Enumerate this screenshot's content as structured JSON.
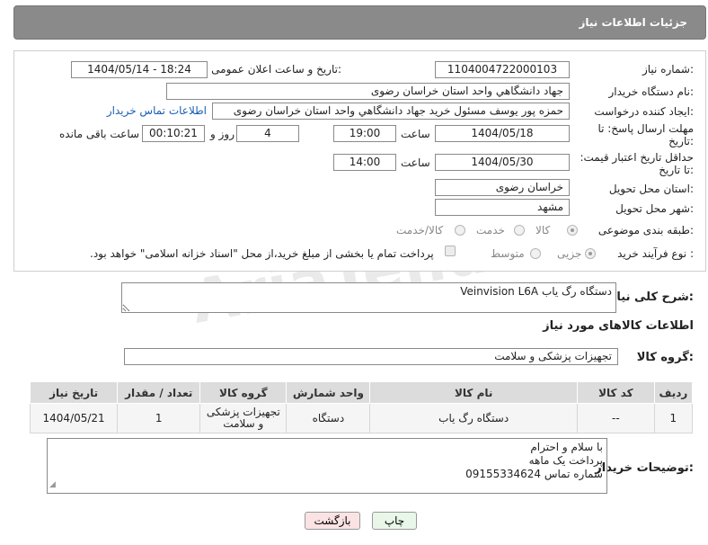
{
  "header": {
    "title": "جزئیات اطلاعات نیاز"
  },
  "form": {
    "need_number": {
      "label": "شماره نیاز:",
      "value": "1104004722000103"
    },
    "announce_datetime": {
      "label": "تاریخ و ساعت اعلان عمومی:",
      "value": "1404/05/14 - 18:24"
    },
    "buyer_org": {
      "label": "نام دستگاه خریدار:",
      "value": "جهاد دانشگاهي واحد استان خراسان رضوی"
    },
    "requester": {
      "label": "ایجاد کننده درخواست:",
      "value": "حمزه  پور یوسف مسئول خرید جهاد دانشگاهي واحد استان خراسان رضوی",
      "contact_link": "اطلاعات تماس خریدار"
    },
    "reply_deadline": {
      "label": "مهلت ارسال پاسخ: تا تاریخ:",
      "date": "1404/05/18",
      "time_label": "ساعت",
      "time": "19:00",
      "days": "4",
      "days_label": "روز و",
      "remaining": "00:10:21",
      "remaining_label": "ساعت باقی مانده"
    },
    "price_validity": {
      "label": "حداقل تاریخ اعتبار قیمت: تا تاریخ:",
      "date": "1404/05/30",
      "time_label": "ساعت",
      "time": "14:00"
    },
    "delivery_province": {
      "label": "استان محل تحویل:",
      "value": "خراسان رضوی"
    },
    "delivery_city": {
      "label": "شهر محل تحویل:",
      "value": "مشهد"
    },
    "category": {
      "label": "طبقه بندی موضوعی:",
      "options": [
        "کالا",
        "خدمت",
        "کالا/خدمت"
      ],
      "selected": "کالا"
    },
    "purchase_type": {
      "label": "نوع فرآیند خرید :",
      "options": [
        "جزیی",
        "متوسط"
      ],
      "selected": "جزیی",
      "note": "پرداخت تمام یا بخشی از مبلغ خرید،از محل \"اسناد خزانه اسلامی\" خواهد بود."
    }
  },
  "description": {
    "label": "شرح کلی نیاز:",
    "value": "دستگاه رگ یاب Veinvision L6A"
  },
  "goods_section": {
    "title": "اطلاعات کالاهای مورد نیاز",
    "group_label": "گروه کالا:",
    "group_value": "تجهیزات پزشکی و سلامت"
  },
  "table": {
    "headers": [
      "ردیف",
      "کد کالا",
      "نام کالا",
      "واحد شمارش",
      "گروه کالا",
      "تعداد / مقدار",
      "تاریخ نیاز"
    ],
    "rows": [
      [
        "1",
        "--",
        "دستگاه رگ یاب",
        "دستگاه",
        "تجهیزات پزشکی و سلامت",
        "1",
        "1404/05/21"
      ]
    ]
  },
  "buyer_notes": {
    "label": "توضیحات خریدار:",
    "lines": [
      "با سلام و احترام",
      "پرداخت یک ماهه",
      "شماره تماس 09155334624"
    ]
  },
  "buttons": {
    "print": "چاپ",
    "back": "بازگشت"
  },
  "watermark": "AriaTender.net",
  "colors": {
    "header_bg": "#8a8a8a",
    "link": "#1a5fb4",
    "print_btn": "#e9f7e9",
    "back_btn": "#fbe3e3"
  }
}
